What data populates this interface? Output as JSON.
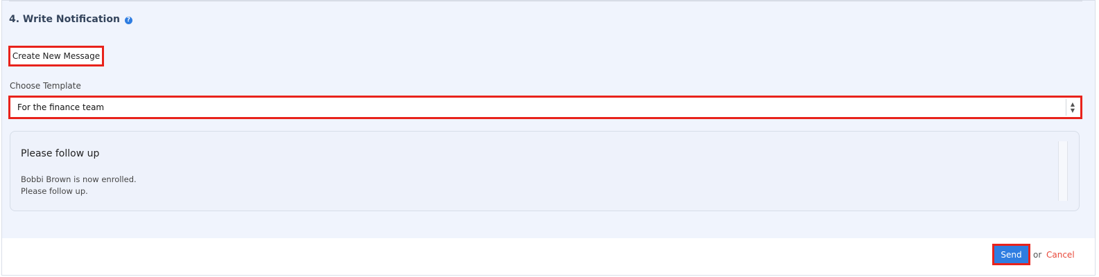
{
  "section": {
    "title": "4. Write Notification",
    "help_icon": "question-circle"
  },
  "create_button": {
    "label": "Create New Message"
  },
  "template": {
    "label": "Choose Template",
    "selected": "For the finance team"
  },
  "preview": {
    "subject": "Please follow up",
    "body_lines": [
      "Bobbi Brown is now enrolled.",
      "Please follow up."
    ]
  },
  "footer": {
    "send_label": "Send",
    "or_text": "or",
    "cancel_label": "Cancel"
  },
  "colors": {
    "panel_bg": "#f0f4fd",
    "accent_blue": "#2f7de1",
    "highlight_red": "#e8221b",
    "cancel_red": "#e8483a"
  }
}
